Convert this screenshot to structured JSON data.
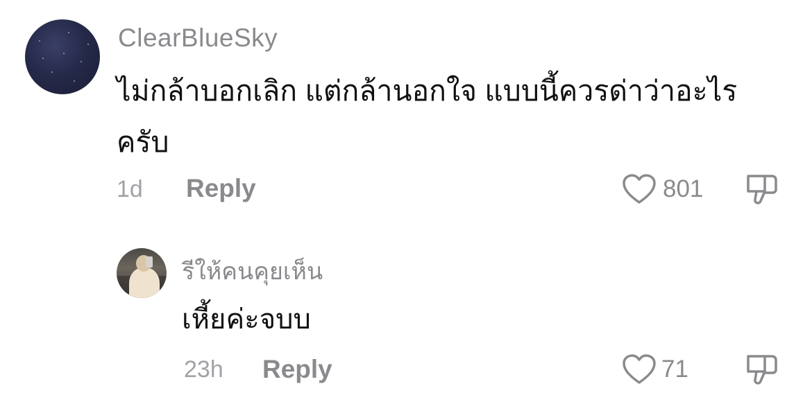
{
  "comments": [
    {
      "username": "ClearBlueSky",
      "text": "ไม่กล้าบอกเลิก แต่กล้านอกใจ แบบนี้ควรด่าว่าอะไรครับ",
      "time": "1d",
      "reply_label": "Reply",
      "likes": "801",
      "avatar": "night-sky-avatar"
    },
    {
      "username": "รีให้คนคุยเห็น",
      "text": "เหี้ยค่ะจบบ",
      "time": "23h",
      "reply_label": "Reply",
      "likes": "71",
      "avatar": "mirror-selfie-avatar"
    }
  ],
  "icons": {
    "like": "heart-outline-icon",
    "dislike": "thumbs-down-outline-icon"
  },
  "colors": {
    "text": "#111111",
    "secondary": "#8a8a8e",
    "timestamp": "#a1a1a6",
    "background": "#ffffff"
  }
}
